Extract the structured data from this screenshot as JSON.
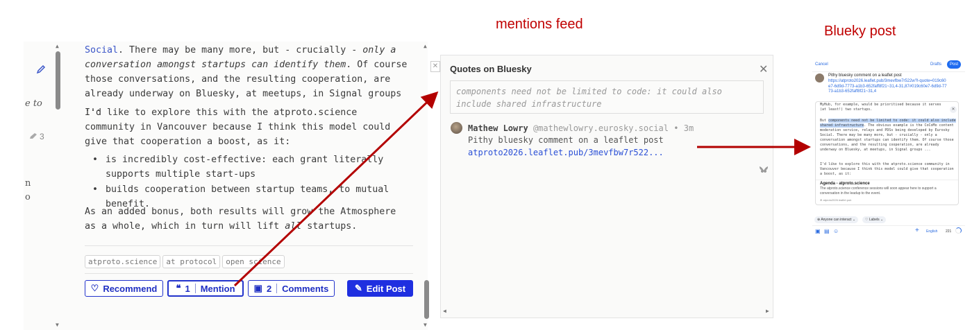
{
  "annotations": {
    "mentions_feed": "mentions feed",
    "bluesky_post": "Blueky post"
  },
  "left_margin": {
    "frag1": "e to",
    "frag2": "n",
    "frag3": "o",
    "badge_count": "3"
  },
  "article": {
    "p1_pre": "Social",
    "p1_a": ". There may be many more, but - crucially - ",
    "p1_em": "only a conversation amongst startups can identify them",
    "p1_b": ". Of course those conversations, and the resulting cooperation, are already underway on Bluesky, at meetups, in Signal groups ...",
    "p2": "I'd like to explore this with the atproto.science community in Vancouver because I think this model could give that cooperation a boost, as it:",
    "bullets": [
      "is incredibly cost-effective: each grant literally supports multiple start-ups",
      "builds cooperation between startup teams, to mutual benefit."
    ],
    "p3_a": "As an added bonus, both results will grow the Atmosphere as a whole, which in turn will lift ",
    "p3_em": "all",
    "p3_b": " startups.",
    "tags": [
      "atproto.science",
      "at protocol",
      "open science"
    ]
  },
  "actions": {
    "recommend": "Recommend",
    "mention_count": "1",
    "mention": "Mention",
    "comments_count": "2",
    "comments": "Comments",
    "edit": "Edit Post"
  },
  "quotes_panel": {
    "title": "Quotes on Bluesky",
    "quote": "components need not be limited to code: it could also include shared infrastructure",
    "author_name": "Mathew Lowry",
    "author_handle": "@mathewlowry.eurosky.social",
    "dot": "•",
    "age": "3m",
    "post_text": "Pithy bluesky comment on a leaflet post",
    "post_link": "atproto2026.leaflet.pub/3mevfbw7r522..."
  },
  "bsky_composer": {
    "cancel": "Cancel",
    "drafts": "Drafts",
    "post": "Post",
    "text": "Pithy bluesky comment on a leaflet post",
    "link": "https://atproto2026.leaflet.pub/3mevfbw7r522w?l-quote=019c60e7-6d9d-7773-a1b3-652faff8f21~31,4-31,87#019c60e7-6d9d-7773-a1b3-652faff8f21~31,4",
    "embed_top": "MyHub, for example, would be prioritised because it serves (at least!) two startups.",
    "embed_but": "But ",
    "embed_hl": "components need not be limited to code: it could also include shared infrastructure",
    "embed_rest": ". The obvious example is the CoCoMo content moderation service, relays and PDSs being developed by Eurosky Social. There may be many more, but - crucially - only a conversation amongst startups can identify them. Of course those conversations, and the resulting cooperation, are already underway on Bluesky, at meetups, in Signal groups ...",
    "embed_p2": "I'd like to explore this with the atproto.science community in Vancouver because I think this model could give that cooperation a boost, as it:",
    "card_title": "Agenda - atproto.science",
    "card_desc": "The atproto.science conference sessions will soon appear here to support a conversation in the leadup to the event.",
    "card_domain": "atproto2026.leaflet.pub",
    "interact": "Anyone can interact",
    "labels": "Labels",
    "lang": "English",
    "count": "221"
  },
  "colors": {
    "accent": "#1f2fc2",
    "link": "#3a55c8",
    "arrow": "#b30000",
    "annotation": "#c00000"
  }
}
